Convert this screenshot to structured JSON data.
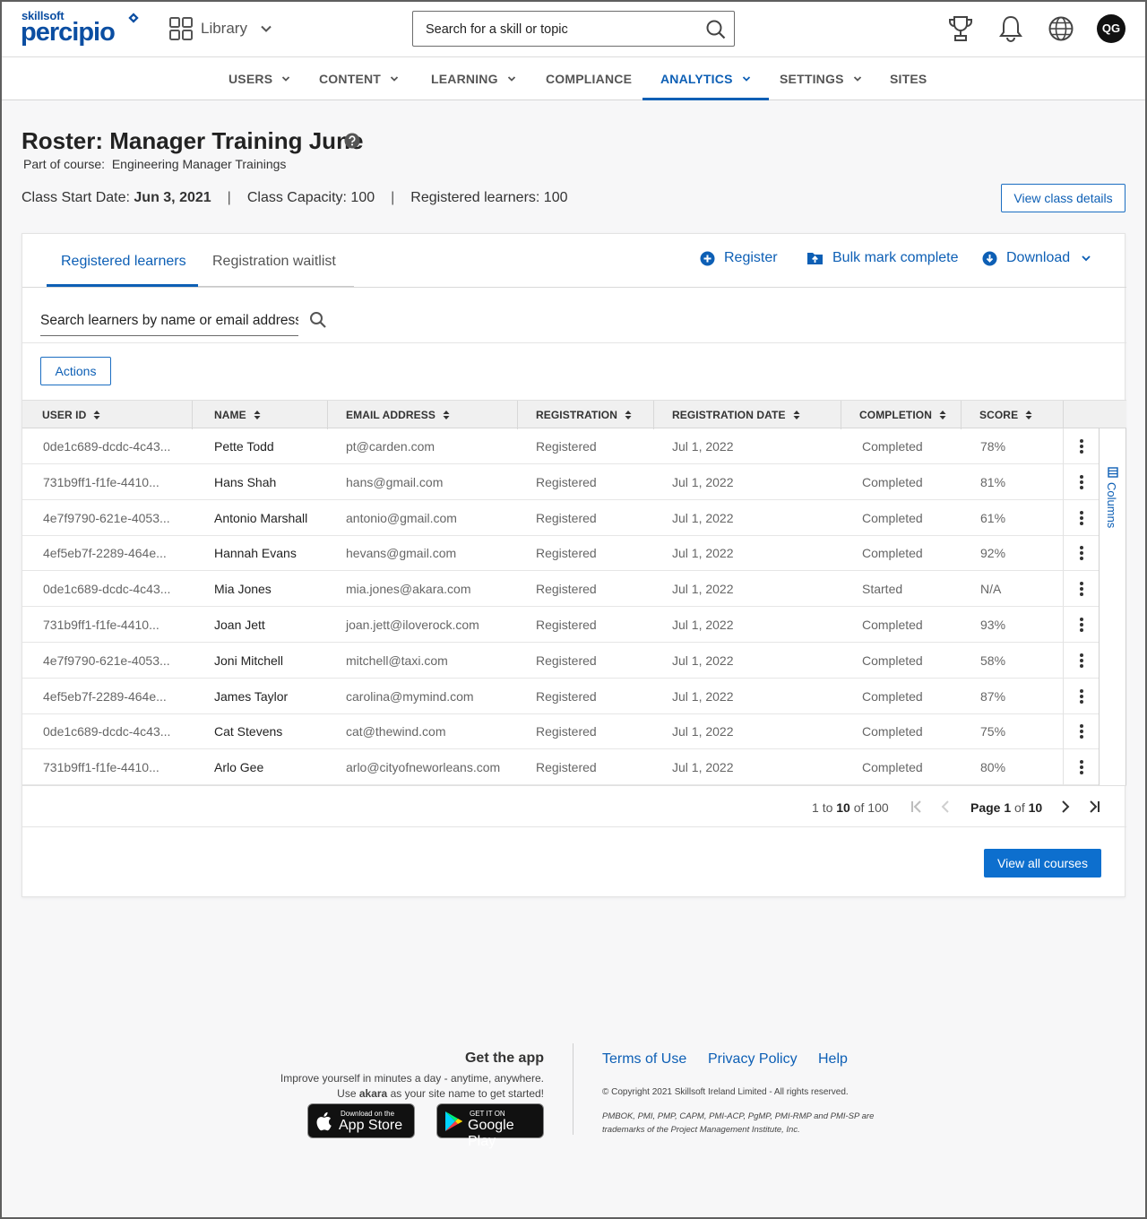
{
  "brand": {
    "small": "skillsoft",
    "big": "percipio"
  },
  "header": {
    "library_label": "Library",
    "search_placeholder": "Search for a skill or topic",
    "avatar_initials": "QG"
  },
  "nav": [
    {
      "label": "USERS",
      "has_menu": true
    },
    {
      "label": "CONTENT",
      "has_menu": true
    },
    {
      "label": "LEARNING",
      "has_menu": true
    },
    {
      "label": "COMPLIANCE",
      "has_menu": false
    },
    {
      "label": "ANALYTICS",
      "has_menu": true,
      "active": true
    },
    {
      "label": "SETTINGS",
      "has_menu": true
    },
    {
      "label": "SITES",
      "has_menu": false
    }
  ],
  "page": {
    "title": "Roster: Manager Training June",
    "course_prefix": "Part of course:",
    "course_name": "Engineering Manager Trainings",
    "start_date_label": "Class Start Date:",
    "start_date": "Jun 3, 2021",
    "capacity": "Class Capacity: 100",
    "registered": "Registered learners: 100",
    "view_class_details": "View class details"
  },
  "tabs": {
    "registered": "Registered learners",
    "waitlist": "Registration waitlist"
  },
  "actions": {
    "register": "Register",
    "bulk": "Bulk mark complete",
    "download": "Download"
  },
  "learner_search_placeholder": "Search learners by name or email address",
  "actions_button": "Actions",
  "table": {
    "columns": [
      "USER ID",
      "NAME",
      "EMAIL ADDRESS",
      "REGISTRATION",
      "REGISTRATION DATE",
      "COMPLETION",
      "SCORE"
    ],
    "rows": [
      [
        "0de1c689-dcdc-4c43...",
        "Pette Todd",
        "pt@carden.com",
        "Registered",
        "Jul 1, 2022",
        "Completed",
        "78%"
      ],
      [
        "731b9ff1-f1fe-4410...",
        "Hans Shah",
        "hans@gmail.com",
        "Registered",
        "Jul 1, 2022",
        "Completed",
        "81%"
      ],
      [
        "4e7f9790-621e-4053...",
        "Antonio Marshall",
        "antonio@gmail.com",
        "Registered",
        "Jul 1, 2022",
        "Completed",
        "61%"
      ],
      [
        "4ef5eb7f-2289-464e...",
        "Hannah Evans",
        "hevans@gmail.com",
        "Registered",
        "Jul 1, 2022",
        "Completed",
        "92%"
      ],
      [
        "0de1c689-dcdc-4c43...",
        "Mia Jones",
        "mia.jones@akara.com",
        "Registered",
        "Jul 1, 2022",
        "Started",
        "N/A"
      ],
      [
        "731b9ff1-f1fe-4410...",
        "Joan Jett",
        "joan.jett@iloverock.com",
        "Registered",
        "Jul 1, 2022",
        "Completed",
        "93%"
      ],
      [
        "4e7f9790-621e-4053...",
        "Joni Mitchell",
        "mitchell@taxi.com",
        "Registered",
        "Jul 1, 2022",
        "Completed",
        "58%"
      ],
      [
        "4ef5eb7f-2289-464e...",
        "James Taylor",
        "carolina@mymind.com",
        "Registered",
        "Jul 1, 2022",
        "Completed",
        "87%"
      ],
      [
        "0de1c689-dcdc-4c43...",
        "Cat Stevens",
        "cat@thewind.com",
        "Registered",
        "Jul 1, 2022",
        "Completed",
        "75%"
      ],
      [
        "731b9ff1-f1fe-4410...",
        "Arlo Gee",
        "arlo@cityofneworleans.com",
        "Registered",
        "Jul 1, 2022",
        "Completed",
        "80%"
      ]
    ],
    "columns_toggle": "Columns"
  },
  "pager": {
    "range_start": "1",
    "range_to": "to",
    "range_end": "10",
    "range_of": "of 100",
    "page_label": "Page",
    "page_current": "1",
    "page_of": "of",
    "page_total": "10"
  },
  "view_all_courses": "View all courses",
  "footer": {
    "get_app": "Get the app",
    "line1": "Improve yourself in minutes a day - anytime, anywhere.",
    "line2_pre": "Use",
    "line2_site": "akara",
    "line2_post": "as your site name to get started!",
    "app_store_small": "Download on the",
    "app_store_big": "App Store",
    "google_small": "GET IT ON",
    "google_big": "Google Play",
    "terms": "Terms of Use",
    "privacy": "Privacy Policy",
    "help": "Help",
    "copyright": "© Copyright 2021 Skillsoft Ireland Limited - All rights reserved.",
    "trademarks": "PMBOK, PMI, PMP, CAPM, PMI-ACP, PgMP, PMI-RMP and PMI-SP are trademarks of the Project Management Institute, Inc."
  },
  "colors": {
    "accent": "#0d5fb5",
    "primary_button": "#0d6fce",
    "brand": "#0b4ea2"
  }
}
